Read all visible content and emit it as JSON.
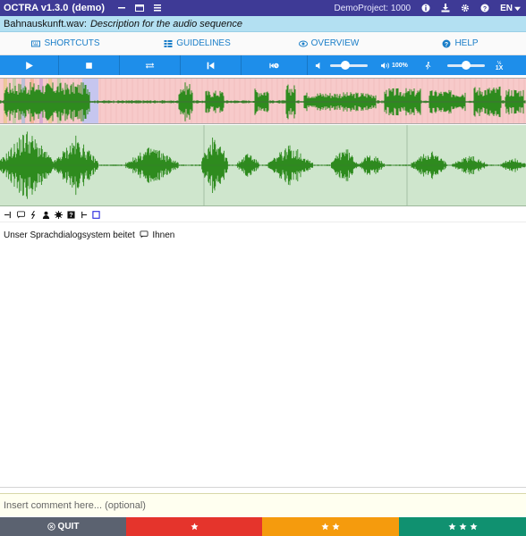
{
  "navbar": {
    "app_title": "OCTRA v1.3.0",
    "demo_label": "(demo)",
    "project_label": "DemoProject: 1000",
    "language": "EN",
    "icons": [
      "minimize-icon",
      "window-icon",
      "menu-list-icon",
      "info-icon",
      "download-icon",
      "gear-icon",
      "help-icon"
    ]
  },
  "filebar": {
    "filename": "Bahnauskunft.wav:",
    "description": "Description for the audio sequence"
  },
  "menu": {
    "shortcuts": "SHORTCUTS",
    "guidelines": "GUIDELINES",
    "overview": "OVERVIEW",
    "help": "HELP"
  },
  "audio": {
    "volume_label": "100%",
    "speed_label": "1X",
    "volume_level": 0.4,
    "speed_level": 0.5
  },
  "transcript": {
    "text_before": "Unser Sprachdialogsystem beitet",
    "text_after": "Ihnen"
  },
  "comment": {
    "placeholder": "Insert comment here... (optional)"
  },
  "footer": {
    "quit_label": "QUIT"
  },
  "colors": {
    "navbar": "#3e3a96",
    "filebar": "#b3e0f2",
    "audiobar": "#1e8eea",
    "waveform": "#2e8b1e",
    "overview_bg": "#f7caca",
    "zoom_bg": "#cfe6cd",
    "quit": "#5b6270",
    "bad": "#e5342c",
    "ok": "#f59b0d",
    "good": "#109170"
  }
}
